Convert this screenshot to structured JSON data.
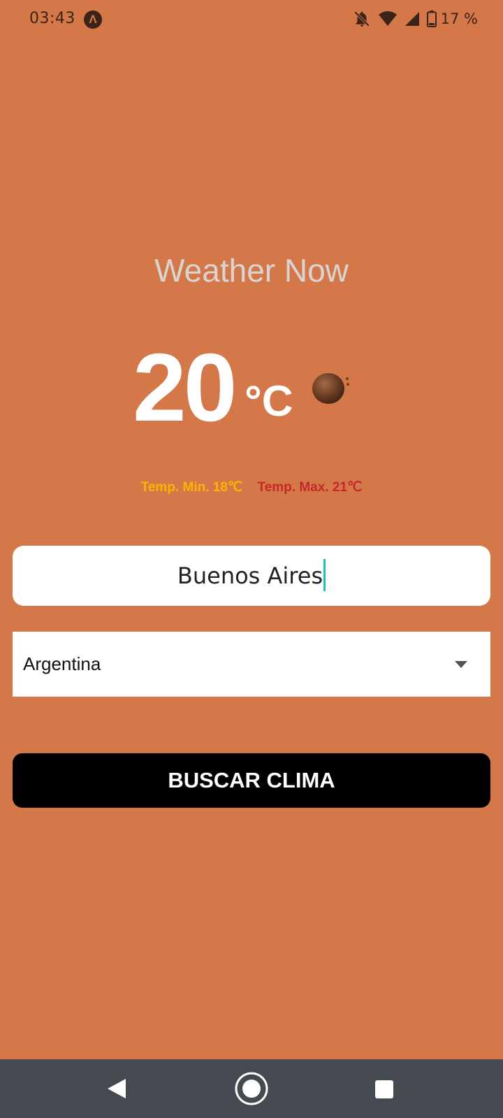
{
  "status_bar": {
    "time": "03:43",
    "expo_glyph": "Λ",
    "battery_text": "17 %",
    "icons": [
      "expo-icon",
      "notifications-off-icon",
      "wifi-icon",
      "cellular-signal-icon",
      "battery-icon"
    ]
  },
  "app": {
    "title": "Weather Now"
  },
  "weather": {
    "temperature": "20",
    "unit": "°C",
    "min_label": "Temp. Min. 18℃",
    "max_label": "Temp. Max. 21℃",
    "icon": "weather-icon"
  },
  "form": {
    "city_value": "Buenos Aires",
    "country_selected": "Argentina",
    "search_button_label": "BUSCAR CLIMA"
  },
  "navigation": {
    "icons": [
      "back-icon",
      "home-icon",
      "recents-icon"
    ]
  },
  "colors": {
    "background": "#D4784A",
    "min_temp": "#FFB300",
    "max_temp": "#C62828",
    "button": "#000000",
    "cursor": "#1fbfb0",
    "nav_bar": "#454a50"
  }
}
